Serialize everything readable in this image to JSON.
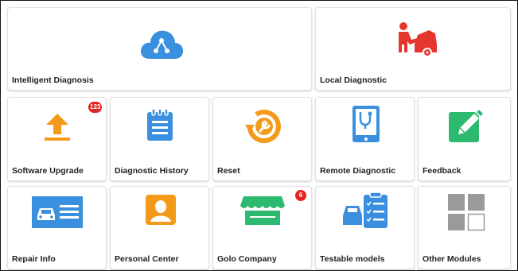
{
  "tiles": {
    "intelligent": {
      "label": "Intelligent Diagnosis",
      "icon": "cloud-share-icon",
      "color": "#3a8fde"
    },
    "local": {
      "label": "Local Diagnostic",
      "icon": "mechanic-car-icon",
      "color": "#e5362d"
    },
    "software": {
      "label": "Software Upgrade",
      "icon": "upload-arrow-icon",
      "color": "#f39a1b",
      "badge": "123"
    },
    "history": {
      "label": "Diagnostic History",
      "icon": "notepad-icon",
      "color": "#3a8fde"
    },
    "reset": {
      "label": "Reset",
      "icon": "wrench-reset-icon",
      "color": "#f39a1b"
    },
    "remote": {
      "label": "Remote Diagnostic",
      "icon": "tablet-stethoscope-icon",
      "color": "#3a8fde"
    },
    "feedback": {
      "label": "Feedback",
      "icon": "edit-pen-icon",
      "color": "#2dba70"
    },
    "repair": {
      "label": "Repair Info",
      "icon": "car-info-icon",
      "color": "#3a8fde"
    },
    "personal": {
      "label": "Personal Center",
      "icon": "user-icon",
      "color": "#f39a1b"
    },
    "golo": {
      "label": "Golo Company",
      "icon": "store-icon",
      "color": "#2dba70",
      "badge": "6"
    },
    "testable": {
      "label": "Testable models",
      "icon": "car-checklist-icon",
      "color": "#3a8fde"
    },
    "other": {
      "label": "Other Modules",
      "icon": "grid-modules-icon",
      "color": "#9a9a9a"
    }
  }
}
